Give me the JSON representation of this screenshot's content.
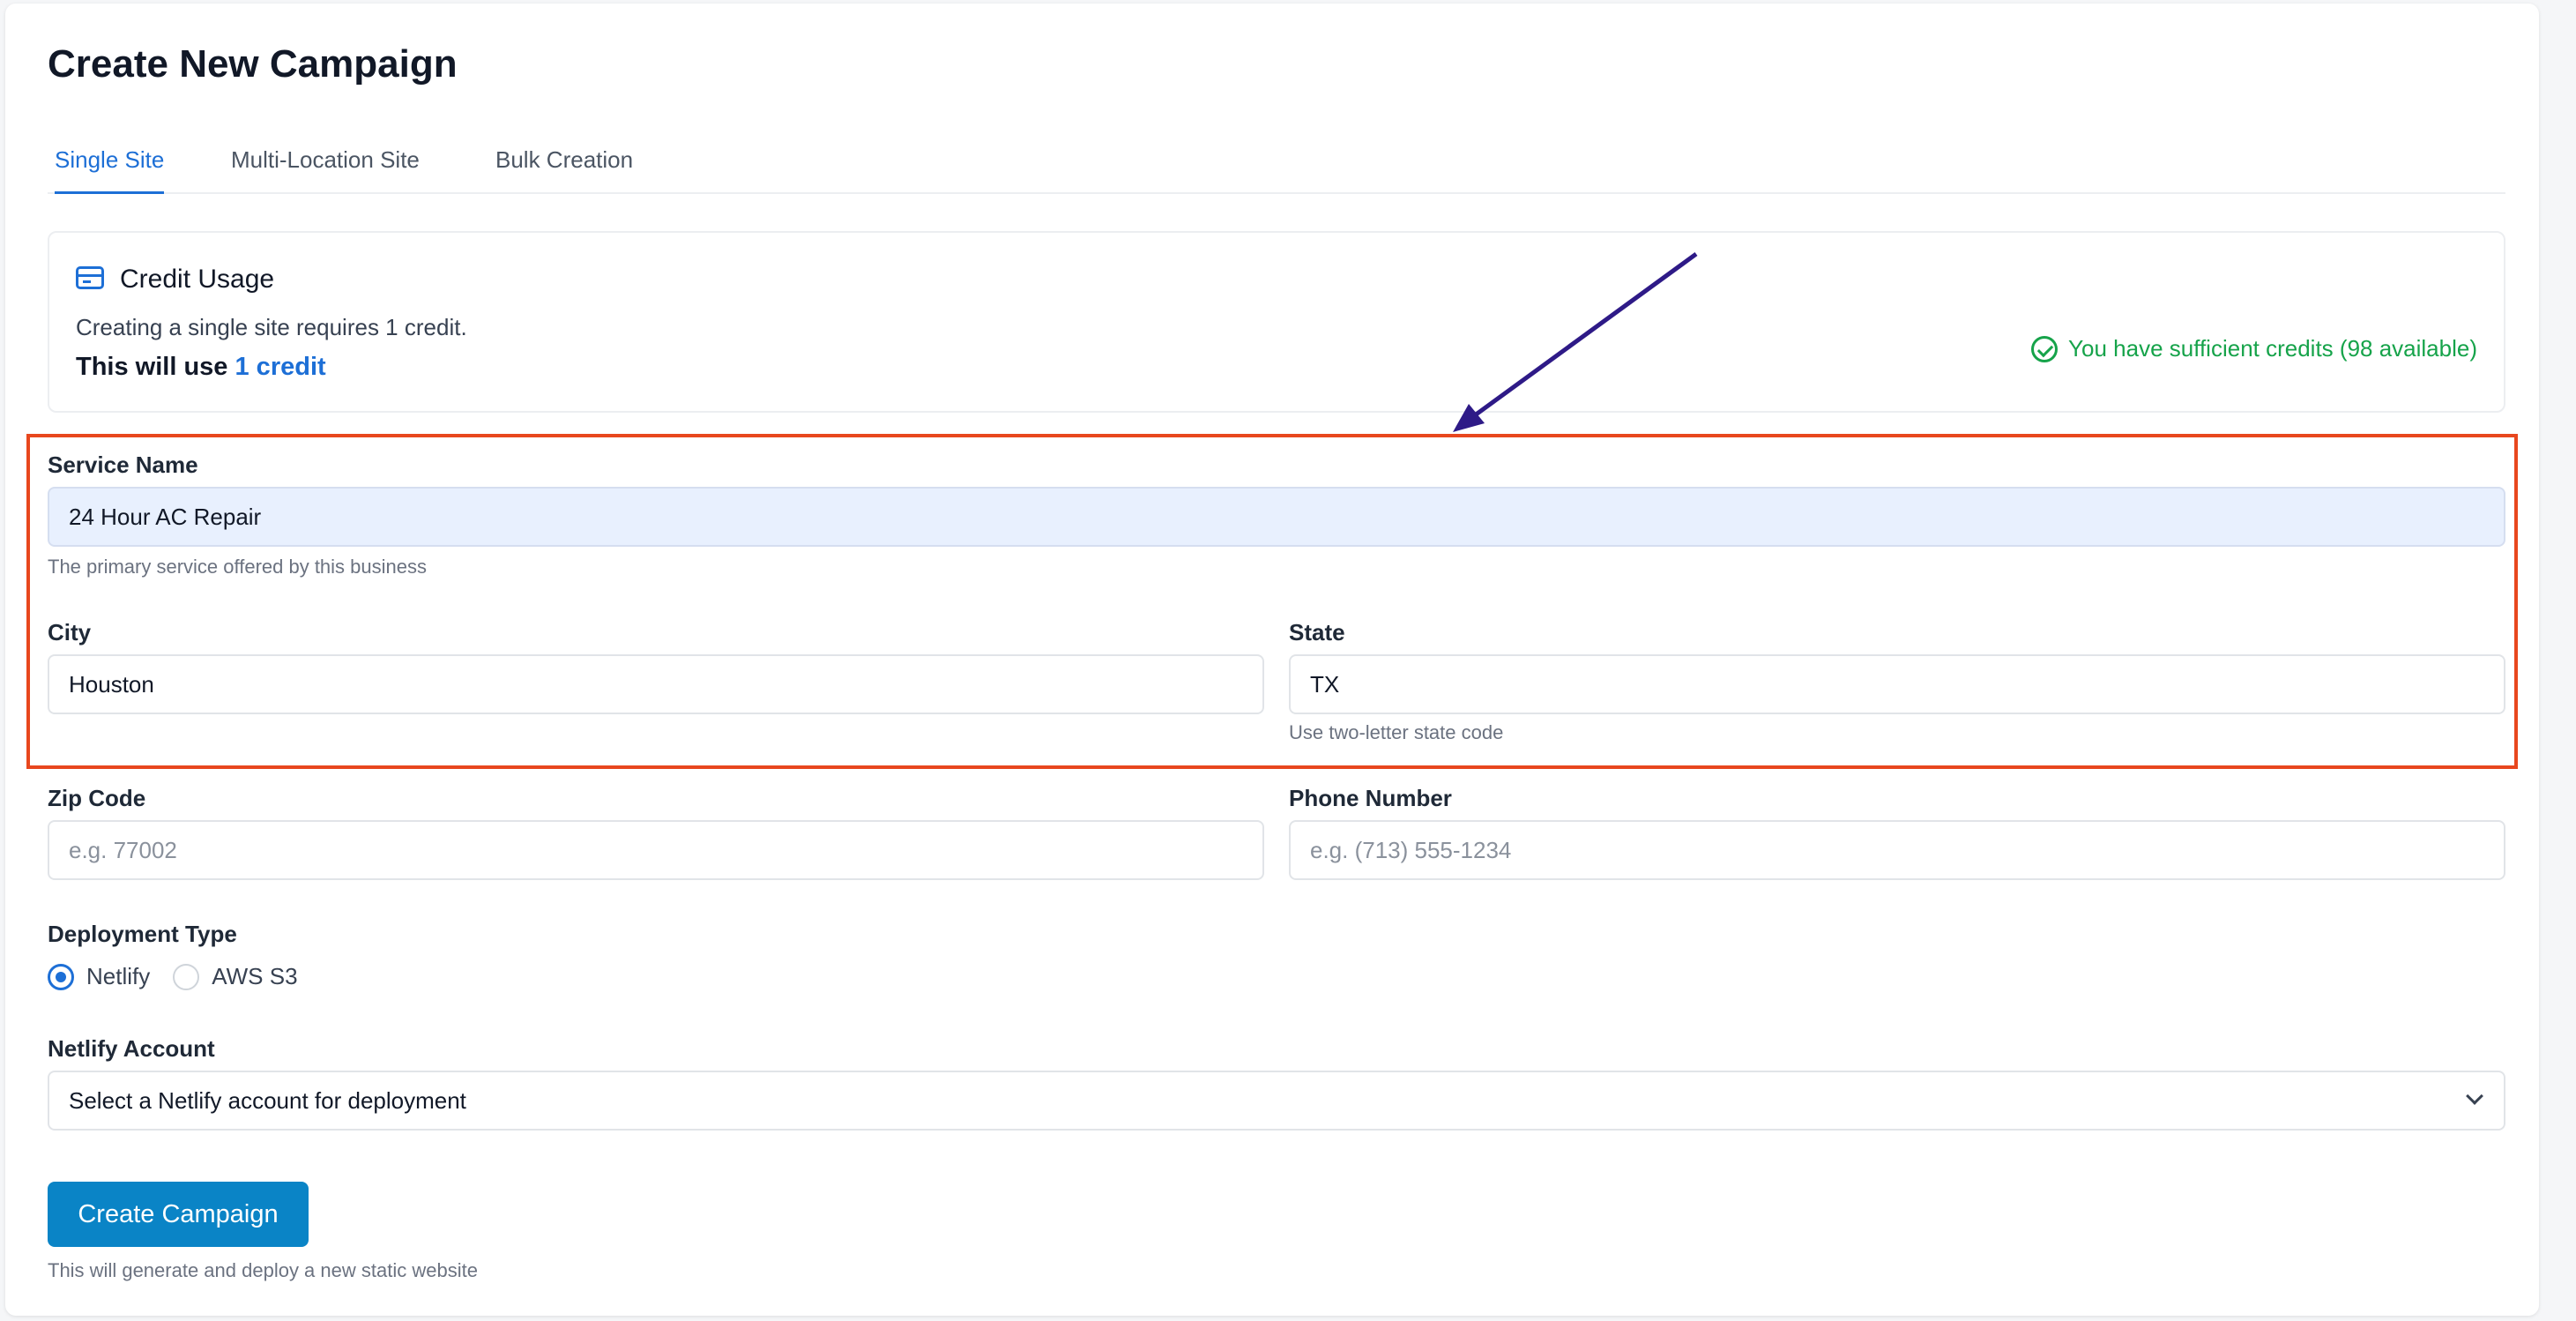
{
  "page": {
    "title": "Create New Campaign"
  },
  "tabs": [
    {
      "label": "Single Site",
      "active": true
    },
    {
      "label": "Multi-Location Site",
      "active": false
    },
    {
      "label": "Bulk Creation",
      "active": false
    }
  ],
  "credit": {
    "title": "Credit Usage",
    "icon": "credit-card-icon",
    "description": "Creating a single site requires 1 credit.",
    "use_prefix": "This will use",
    "use_amount": "1 credit",
    "status": "You have sufficient credits (98 available)",
    "status_icon": "check-circle-icon"
  },
  "form": {
    "service_name": {
      "label": "Service Name",
      "value": "24 Hour AC Repair",
      "hint": "The primary service offered by this business"
    },
    "city": {
      "label": "City",
      "value": "Houston"
    },
    "state": {
      "label": "State",
      "value": "TX",
      "hint": "Use two-letter state code"
    },
    "zip": {
      "label": "Zip Code",
      "placeholder": "e.g. 77002"
    },
    "phone": {
      "label": "Phone Number",
      "placeholder": "e.g. (713) 555-1234"
    },
    "deployment": {
      "label": "Deployment Type",
      "options": [
        {
          "label": "Netlify",
          "checked": true
        },
        {
          "label": "AWS S3",
          "checked": false
        }
      ]
    },
    "netlify_account": {
      "label": "Netlify Account",
      "selected": "Select a Netlify account for deployment"
    }
  },
  "submit": {
    "label": "Create Campaign",
    "hint": "This will generate and deploy a new static website"
  },
  "colors": {
    "accent": "#1d6fd6",
    "success": "#16a34a",
    "button": "#0a84c6",
    "highlight": "#e8471e",
    "annotation_arrow": "#2e1a87"
  }
}
